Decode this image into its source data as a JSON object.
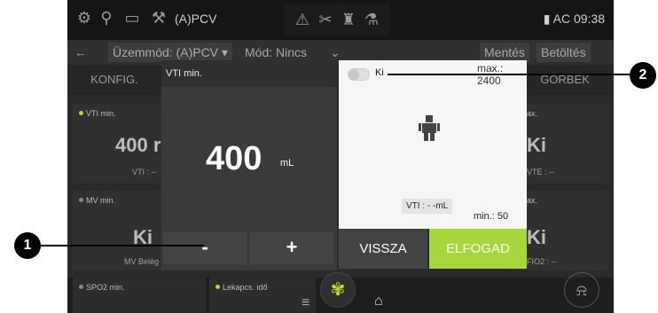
{
  "statusbar": {
    "mode": "(A)PCV",
    "clock": "AC 09:38"
  },
  "toolbar": {
    "back": "←",
    "mode": "Üzemmód: (A)PCV",
    "sub_mode": "Mód: Nincs",
    "save": "Mentés",
    "load": "Betöltés"
  },
  "tabs": {
    "left": "KONFIG.",
    "right": "GÖRBÉK"
  },
  "tiles": {
    "vti_min": {
      "label": "VTI min.",
      "value": "400 r",
      "sub": "VTI : --"
    },
    "max_top": {
      "label": "ax.",
      "value": "Ki",
      "sub": "VTE : --"
    },
    "mv_min": {
      "label": "MV min.",
      "value": "Ki",
      "sub": "MV Belég"
    },
    "max_bottom": {
      "label": "ax.",
      "value": "Ki",
      "sub": "FIO2 : --"
    },
    "spo2": {
      "label": "SPO2 min."
    },
    "lekapcs": {
      "label": "Lekapcs. idő"
    }
  },
  "dialog": {
    "title": "VTI min.",
    "value": "400",
    "unit": "mL",
    "minus": "-",
    "plus": "+",
    "toggle_label": "Ki",
    "max": "max.: 2400",
    "vti": "VTI : - -mL",
    "min": "min.: 50",
    "back": "VISSZA",
    "accept": "ELFOGAD"
  },
  "callouts": {
    "one": "1",
    "two": "2"
  },
  "colors": {
    "accent": "#a5d63a",
    "dark": "#2a2a2a"
  },
  "icons": [
    "hand-icon",
    "sensor-icon",
    "ventilator-icon",
    "warning-icon",
    "tools-icon",
    "patient-icon",
    "battery-icon",
    "menu-icon",
    "home-icon",
    "fan-icon",
    "alarm-bell-icon"
  ]
}
